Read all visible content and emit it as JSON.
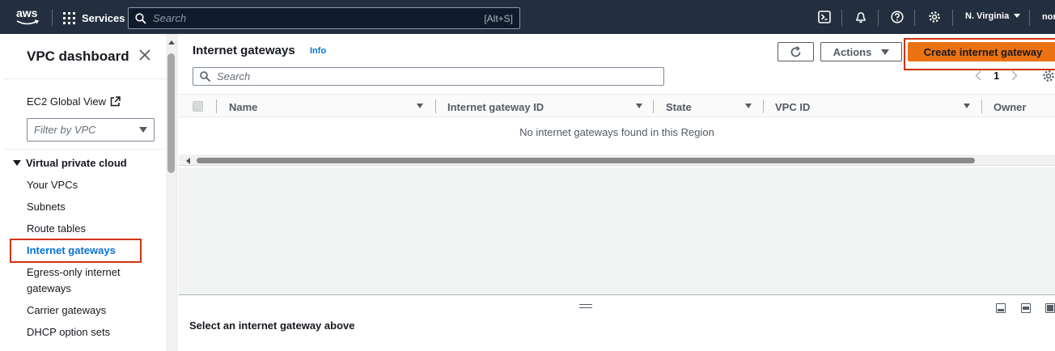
{
  "topnav": {
    "logo_text": "aws",
    "services_label": "Services",
    "search_placeholder": "Search",
    "search_shortcut": "[Alt+S]",
    "region_label": "N. Virginia",
    "user_label": "nor"
  },
  "sidebar": {
    "title": "VPC dashboard",
    "global_view": "EC2 Global View",
    "filter_placeholder": "Filter by VPC",
    "section_title": "Virtual private cloud",
    "items": [
      {
        "label": "Your VPCs"
      },
      {
        "label": "Subnets"
      },
      {
        "label": "Route tables"
      },
      {
        "label": "Internet gateways"
      },
      {
        "label": "Egress-only internet gateways"
      },
      {
        "label": "Carrier gateways"
      },
      {
        "label": "DHCP option sets"
      }
    ]
  },
  "main": {
    "title": "Internet gateways",
    "info_link": "Info",
    "actions_label": "Actions",
    "create_label": "Create internet gateway",
    "search_placeholder": "Search",
    "page_number": "1",
    "columns": [
      "Name",
      "Internet gateway ID",
      "State",
      "VPC ID",
      "Owner"
    ],
    "empty_message": "No internet gateways found in this Region",
    "detail_title": "Select an internet gateway above"
  },
  "colors": {
    "nav_bg": "#232f3e",
    "primary": "#ec7211",
    "link": "#0972d3",
    "highlight": "#d13212"
  }
}
